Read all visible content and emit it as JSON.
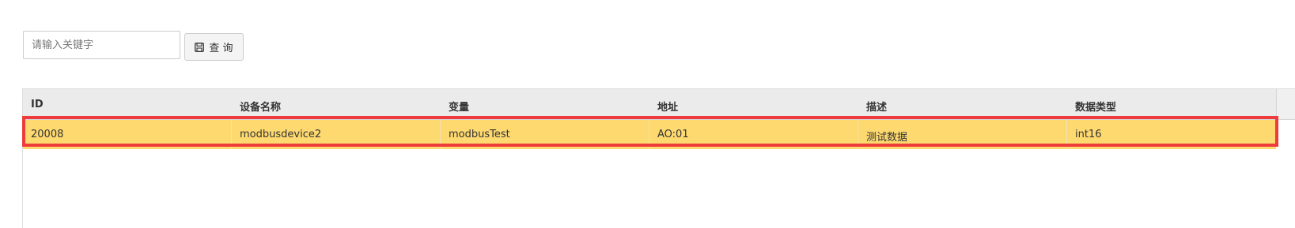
{
  "search": {
    "placeholder": "请输入关键字",
    "button_label": "查 询",
    "button_icon": "save-icon"
  },
  "table": {
    "columns": [
      "ID",
      "设备名称",
      "变量",
      "地址",
      "描述",
      "数据类型"
    ],
    "rows": [
      [
        "20008",
        "modbusdevice2",
        "modbusTest",
        "AO:01",
        "测试数据",
        "int16"
      ]
    ],
    "selected_row_color": "#fdd96f",
    "header_color": "#ebebeb"
  },
  "highlight": {
    "color": "#ee3b3b"
  }
}
